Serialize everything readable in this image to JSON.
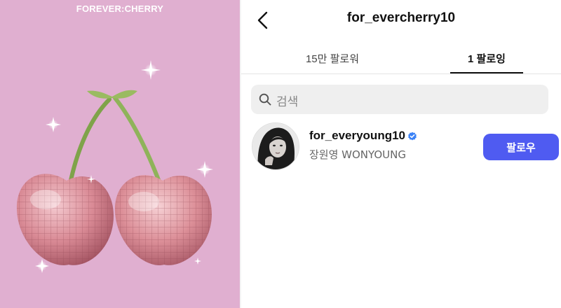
{
  "left": {
    "brand": "FOREVER:CHERRY",
    "background": "#e0afd0"
  },
  "header": {
    "back_icon": "chevron-left-icon",
    "title": "for_evercherry10"
  },
  "tabs": [
    {
      "label": "15만 팔로워",
      "active": false
    },
    {
      "label": "1 팔로잉",
      "active": true
    }
  ],
  "search": {
    "icon": "search-icon",
    "placeholder": "검색"
  },
  "following": [
    {
      "username": "for_everyoung10",
      "verified": true,
      "full_name": "장원영 WONYOUNG",
      "action_label": "팔로우"
    }
  ],
  "colors": {
    "accent": "#4f5bf1",
    "verified": "#3b82f6",
    "search_bg": "#efefef"
  }
}
